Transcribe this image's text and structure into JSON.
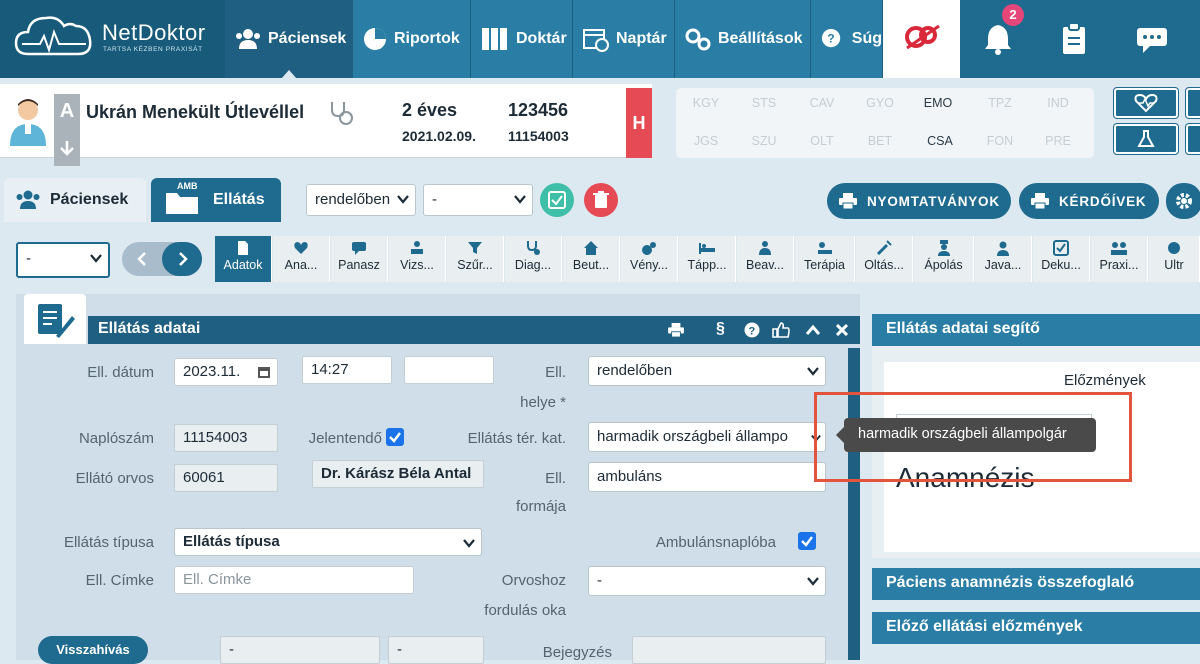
{
  "app": {
    "brand": "NetDoktor",
    "tagline": "TARTSA KÉZBEN PRAXISÁT"
  },
  "nav": [
    {
      "label": "Páciensek",
      "icon": "users-icon"
    },
    {
      "label": "Riportok",
      "icon": "pie-chart-icon"
    },
    {
      "label": "Doktár",
      "icon": "archive-icon"
    },
    {
      "label": "Naptár",
      "icon": "calendar-icon"
    },
    {
      "label": "Beállítások",
      "icon": "gears-icon"
    },
    {
      "label": "Súg",
      "icon": "help-chat-icon"
    }
  ],
  "notifications": {
    "count": "2"
  },
  "patient": {
    "name": "Ukrán Menekült Útlevéllel",
    "age": "2 éves",
    "dob": "2021.02.09.",
    "id": "123456",
    "id2": "11154003",
    "flag": "H",
    "side_a": "A"
  },
  "codes": {
    "row1": [
      "KGY",
      "STS",
      "CAV",
      "GYO",
      "EMO",
      "TPZ",
      "IND"
    ],
    "row2": [
      "JGS",
      "SZU",
      "OLT",
      "BET",
      "CSA",
      "FON",
      "PRE"
    ],
    "active": [
      "EMO",
      "CSA"
    ]
  },
  "tabs": {
    "patients": "Páciensek",
    "care": "Ellátás",
    "care_badge": "AMB"
  },
  "top_selects": {
    "location": "rendelőben",
    "second": "-"
  },
  "actions": {
    "forms": "NYOMTATVÁNYOK",
    "questionnaires": "KÉRDŐÍVEK"
  },
  "toolbar": {
    "left_select": "-",
    "items": [
      "Adatok",
      "Ana...",
      "Panasz",
      "Vizs...",
      "Szűr...",
      "Diag...",
      "Beut...",
      "Vény...",
      "Tápp...",
      "Beav...",
      "Terápia",
      "Oltás...",
      "Ápolás",
      "Java...",
      "Deku...",
      "Praxi...",
      "Ultr"
    ],
    "active": "Adatok"
  },
  "form": {
    "title": "Ellátás adatai",
    "fields": {
      "date_label": "Ell. dátum",
      "date_value": "2023.11.",
      "time_value": "14:27",
      "place_label_1": "Ell.",
      "place_label_2": "helye *",
      "place_value": "rendelőben",
      "log_label": "Naplószám",
      "log_value": "11154003",
      "reportable_label": "Jelentendő",
      "category_label": "Ellátás tér. kat.",
      "category_value": "harmadik országbeli állampo",
      "doctor_label": "Ellátó orvos",
      "doctor_code": "60061",
      "doctor_name": "Dr. Kárász Béla Antal",
      "form_label_1": "Ell.",
      "form_label_2": "formája",
      "form_value": "ambuláns",
      "type_label": "Ellátás típusa",
      "type_value": "Ellátás típusa",
      "ambulance_label": "Ambulánsnaplóba",
      "tag_label": "Ell. Címke",
      "tag_placeholder": "Ell. Címke",
      "reason_label_1": "Orvoshoz",
      "reason_label_2": "fordulás oka",
      "reason_value": "-",
      "recall_button": "Visszahívás",
      "recall_value_1": "-",
      "recall_value_2": "-",
      "entry_label": "Bejegyzés"
    }
  },
  "side": {
    "helper_title": "Ellátás adatai segítő",
    "history_label": "Előzmények",
    "anamnesis_text": "Anamnézis",
    "summary_title": "Páciens anamnézis összefoglaló",
    "previous_title": "Előző ellátási előzmények"
  },
  "tooltip": {
    "text": "harmadik országbeli állampolgár"
  },
  "colors": {
    "primary": "#1f6a8f",
    "dark": "#1f5f82",
    "highlight": "#e2543c",
    "badge": "#e4467a",
    "alert": "#e64a55"
  }
}
